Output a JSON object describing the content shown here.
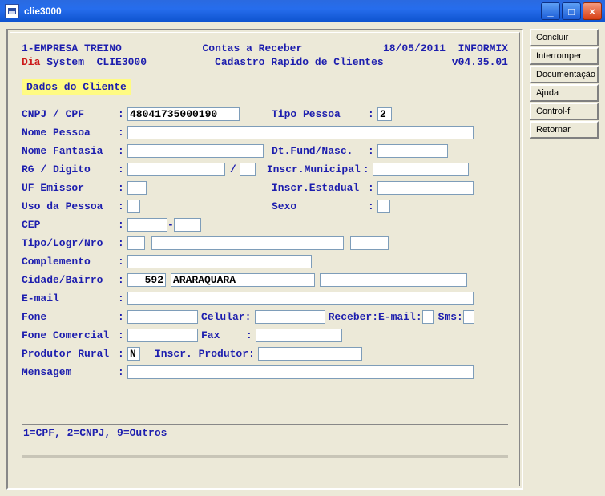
{
  "window": {
    "title": "clie3000"
  },
  "sidebar": {
    "items": [
      {
        "label": "Concluir"
      },
      {
        "label": "Interromper"
      },
      {
        "label": "Documentação"
      },
      {
        "label": "Ajuda"
      },
      {
        "label": "Control-f"
      },
      {
        "label": "Retornar"
      }
    ]
  },
  "header": {
    "company": "1-EMPRESA TREINO",
    "module": "Contas a Receber",
    "date": "18/05/2011",
    "db": "INFORMIX",
    "dia_prefix": "Dia",
    "dia_rest": " System  CLIE3000",
    "subtitle": "Cadastro Rapido de Clientes",
    "version": "v04.35.01"
  },
  "section": {
    "title": "Dados do Cliente"
  },
  "labels": {
    "cnpj_cpf": "CNPJ / CPF",
    "tipo_pessoa": "Tipo Pessoa",
    "nome_pessoa": "Nome Pessoa",
    "nome_fantasia": "Nome Fantasia",
    "dt_fund_nasc": "Dt.Fund/Nasc.",
    "rg_digito": "RG / Digito",
    "inscr_municipal": "Inscr.Municipal",
    "uf_emissor": "UF Emissor",
    "inscr_estadual": "Inscr.Estadual",
    "uso_pessoa": "Uso da Pessoa",
    "sexo": "Sexo",
    "cep": "CEP",
    "cep_dash": "-",
    "tipo_logr_nro": "Tipo/Logr/Nro",
    "complemento": "Complemento",
    "cidade_bairro": "Cidade/Bairro",
    "email": "E-mail",
    "fone": "Fone",
    "celular": "Celular",
    "receber": "Receber:",
    "receber_email": "E-mail:",
    "sms": "Sms:",
    "fone_comercial": "Fone Comercial",
    "fax": "Fax",
    "produtor_rural": "Produtor Rural",
    "inscr_produtor": "Inscr. Produtor",
    "mensagem": "Mensagem",
    "slash": "/"
  },
  "fields": {
    "cnpj_cpf": "48041735000190",
    "tipo_pessoa": "2",
    "nome_pessoa": "",
    "nome_fantasia": "",
    "dt_fund_nasc": "",
    "rg": "",
    "rg_digito": "",
    "inscr_municipal": "",
    "uf_emissor": "",
    "inscr_estadual": "",
    "uso_pessoa": "",
    "sexo": "",
    "cep1": "",
    "cep2": "",
    "tipo": "",
    "logr": "",
    "nro": "",
    "complemento": "",
    "cidade_cod": "592",
    "cidade_nome": "ARARAQUARA",
    "bairro": "",
    "email_val": "",
    "fone": "",
    "celular": "",
    "receber_email": "",
    "sms": "",
    "fone_comercial": "",
    "fax": "",
    "produtor_rural": "N",
    "inscr_produtor": "",
    "mensagem": ""
  },
  "help": {
    "text": "1=CPF, 2=CNPJ, 9=Outros"
  }
}
